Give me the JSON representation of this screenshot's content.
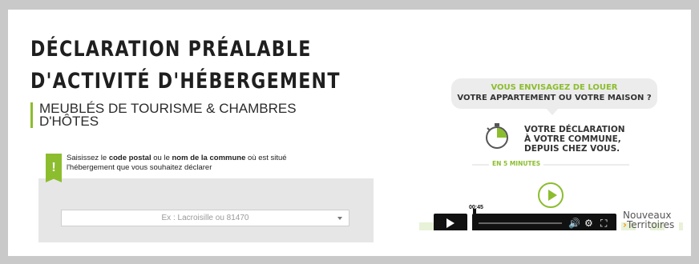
{
  "page": {
    "title_lines": [
      "DÉCLARATION PRÉALABLE",
      "D'ACTIVITÉ D'HÉBERGEMENT"
    ],
    "subtitle": "MEUBLÉS DE TOURISME & CHAMBRES D'HÔTES"
  },
  "notice": {
    "icon_glyph": "!",
    "text_before": "Saisissez le ",
    "bold1": "code postal",
    "text_middle": " ou le ",
    "bold2": "nom de la commune",
    "text_after": " où est situé l'hébergement que vous souhaitez déclarer"
  },
  "commune_select": {
    "placeholder": "Ex : Lacroisille ou 81470"
  },
  "video": {
    "bubble_line1": "VOUS ENVISAGEZ DE LOUER",
    "bubble_line2": "VOTRE APPARTEMENT OU VOTRE MAISON ?",
    "message_lines": [
      "VOTRE DÉCLARATION",
      "À VOTRE COMMUNE,",
      "DEPUIS CHEZ VOUS."
    ],
    "duration_label": "EN 5 MINUTES",
    "current_time": "00:45",
    "progress": 0.03,
    "logo_line1": "Nouveaux",
    "logo_arrow": "›",
    "logo_line2": "Territoires"
  },
  "colors": {
    "accent_green": "#8cbd2e",
    "logo_orange": "#f39c12"
  },
  "icons": [
    "exclamation-icon",
    "chevron-down-icon",
    "timer-icon",
    "play-icon",
    "volume-icon",
    "settings-icon",
    "fullscreen-icon"
  ]
}
